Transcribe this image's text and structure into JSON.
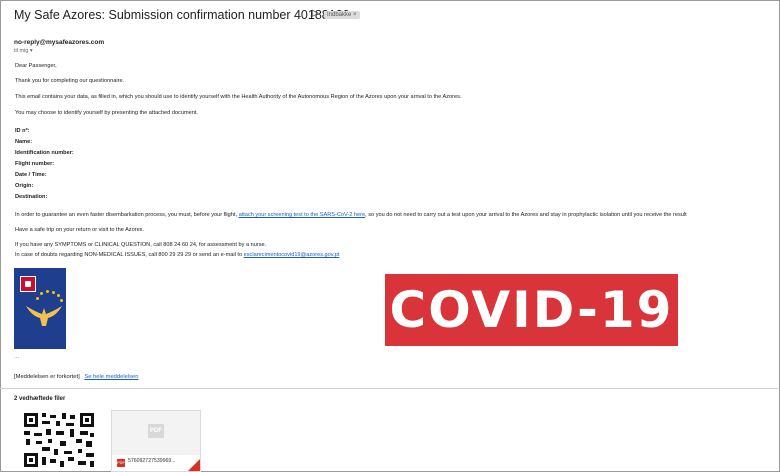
{
  "email": {
    "subject": "My Safe Azores: Submission confirmation number 40188120",
    "label_badge": "Indbakke ×",
    "sender": "no-reply@mysafeazores.com",
    "to": "til mig ▾",
    "greeting": "Dear Passenger,",
    "thanks": "Thank you for completing our questionnaire.",
    "info": "This email contains your data, as filled in, which you should use to identify yourself with the Health Authority of the Autonomous Region of the Azores upon your arrival to the Azores.",
    "doc_note": "You may choose to identify yourself by presenting the attached document.",
    "fields": {
      "id": "ID nº:",
      "name": "Name:",
      "idnum": "Identification number:",
      "flight": "Flight number:",
      "datetime": "Date / Time:",
      "origin": "Origin:",
      "destination": "Destination:"
    },
    "guarantee_pre": "In order to guarantee an even faster disembarkation process, you must, before your flight,",
    "guarantee_link": "attach your screening test to the SARS-CoV-2 here",
    "guarantee_post": ", so you do not need to carry out a test upon your arrival to the Azores and stay in prophylactic isolation until you receive the result",
    "safe_trip": "Have a safe trip on your return or visit to the Azores.",
    "symptoms": "If you have any SYMPTOMS or CLINICAL QUESTION, call 808 24 60 24, for assessment by a nurse.",
    "doubts_pre": "In case of doubts regarding NON-MEDICAL ISSUES, call 800 29 29 29 or send an e-mail to",
    "doubts_email": "esclarecimentocovid19@azores.gov.pt",
    "covid_banner": "COVID-19",
    "ellipsis": "...",
    "truncated": "[Meddelelsen er forkortet]",
    "view_full": "Se hele meddelelsen"
  },
  "attachments": {
    "title": "2 vedhæftede filer",
    "pdf_ghost": "PDF",
    "pdf_badge": "PDF",
    "pdf_name": "576092727539969..."
  },
  "colors": {
    "link": "#1a5dc9",
    "covid_red": "#d9343a",
    "flag_blue": "#1f3f8e"
  }
}
